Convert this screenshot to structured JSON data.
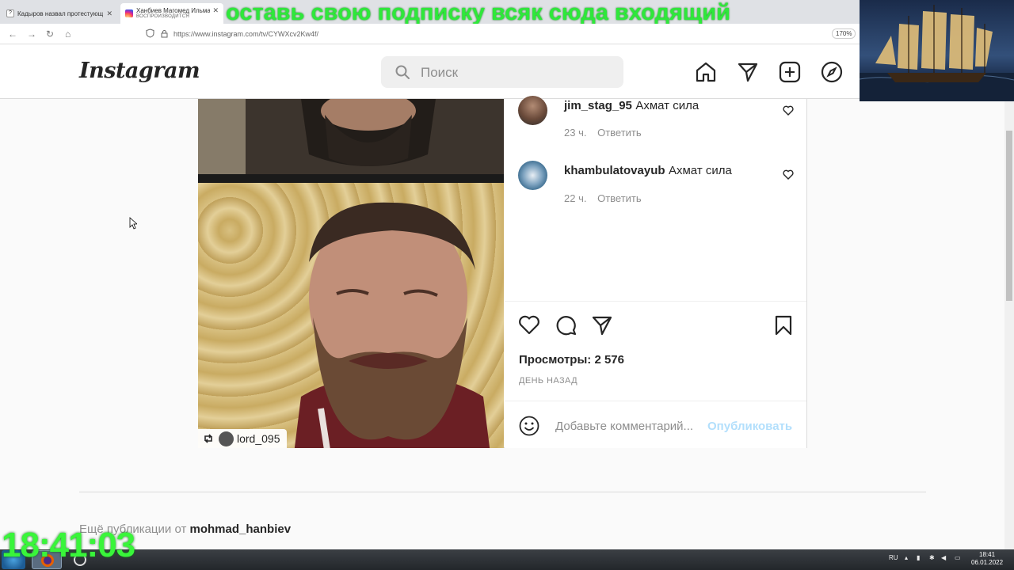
{
  "browser": {
    "tabs": [
      {
        "title": "Кадыров назвал протестующ",
        "close": "✕"
      },
      {
        "title": "Ханбиев Магомед Ильманович",
        "subtitle": "ВОСПРОИЗВОДИТСЯ",
        "close": "✕"
      }
    ],
    "url": "https://www.instagram.com/tv/CYWXcv2Kw4f/",
    "zoom": "170%"
  },
  "overlay": {
    "banner": "оставь свою подписку всяк сюда входящий",
    "clock": "18:41:03"
  },
  "header": {
    "logo": "Instagram",
    "search_placeholder": "Поиск",
    "icons": [
      "home-icon",
      "direct-icon",
      "new-post-icon",
      "explore-icon"
    ]
  },
  "post": {
    "repost_user": "lord_095",
    "comments": [
      {
        "user": "jim_stag_95",
        "text": "Ахмат сила",
        "time": "23 ч.",
        "reply": "Ответить"
      },
      {
        "user": "khambulatovayub",
        "text": "Ахмат сила",
        "time": "22 ч.",
        "reply": "Ответить"
      }
    ],
    "views_label": "Просмотры:",
    "views_value": "2 576",
    "when": "ДЕНЬ НАЗАД",
    "comment_placeholder": "Добавьте комментарий...",
    "publish": "Опубликовать"
  },
  "more": {
    "prefix": "Ещё публикации от",
    "user": "mohmad_hanbiev"
  },
  "taskbar": {
    "lang": "RU",
    "time": "18:41",
    "date": "06.01.2022"
  },
  "colors": {
    "banner_green": "#2ee83a",
    "publish_disabled": "#b2dffc",
    "clock_green": "#39f53a"
  }
}
